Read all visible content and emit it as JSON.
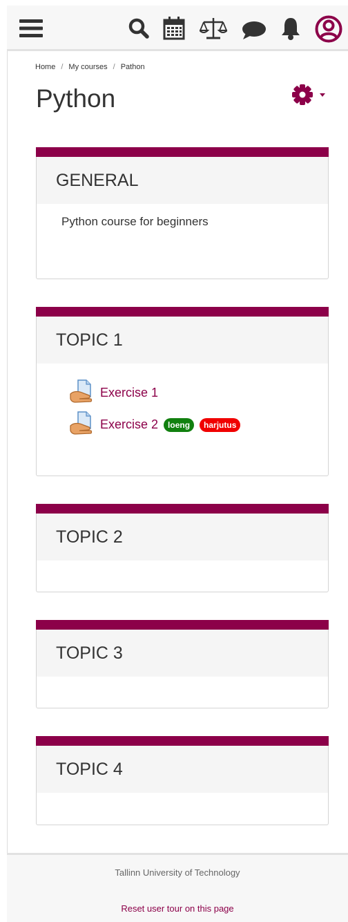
{
  "navbar": {
    "icons": [
      "menu-icon",
      "search-icon",
      "calendar-icon",
      "scales-icon",
      "chat-icon",
      "bell-icon",
      "user-avatar-icon"
    ]
  },
  "breadcrumb": {
    "home": "Home",
    "my_courses": "My courses",
    "current": "Pathon"
  },
  "page": {
    "title": "Python"
  },
  "sections": [
    {
      "title": "GENERAL",
      "summary": "Python course for beginners"
    },
    {
      "title": "TOPIC 1",
      "activities": [
        {
          "label": "Exercise 1"
        },
        {
          "label": "Exercise 2",
          "badges": [
            "loeng",
            "harjutus"
          ]
        }
      ]
    },
    {
      "title": "TOPIC 2"
    },
    {
      "title": "TOPIC 3"
    },
    {
      "title": "TOPIC 4"
    }
  ],
  "footer": {
    "org": "Tallinn University of Technology",
    "reset_tour": "Reset user tour on this page"
  },
  "colors": {
    "brand": "#8c0049",
    "badge_green": "#11800f",
    "badge_red": "#f00000"
  }
}
